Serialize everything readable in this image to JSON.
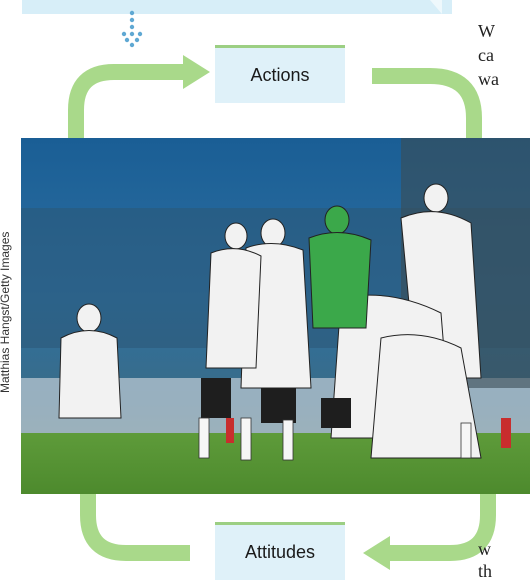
{
  "diagram": {
    "top_label": "Actions",
    "bottom_label": "Attitudes"
  },
  "photo": {
    "credit": "Matthias Hangst/Getty Images"
  },
  "side_text": {
    "lines_top": [
      "W",
      "ca",
      "wa"
    ],
    "lines_bottom": [
      "w",
      "th"
    ]
  },
  "colors": {
    "arrow_green": "#a9d98a",
    "box_blue": "#dff1f9",
    "dots_blue": "#5fa8d3"
  }
}
